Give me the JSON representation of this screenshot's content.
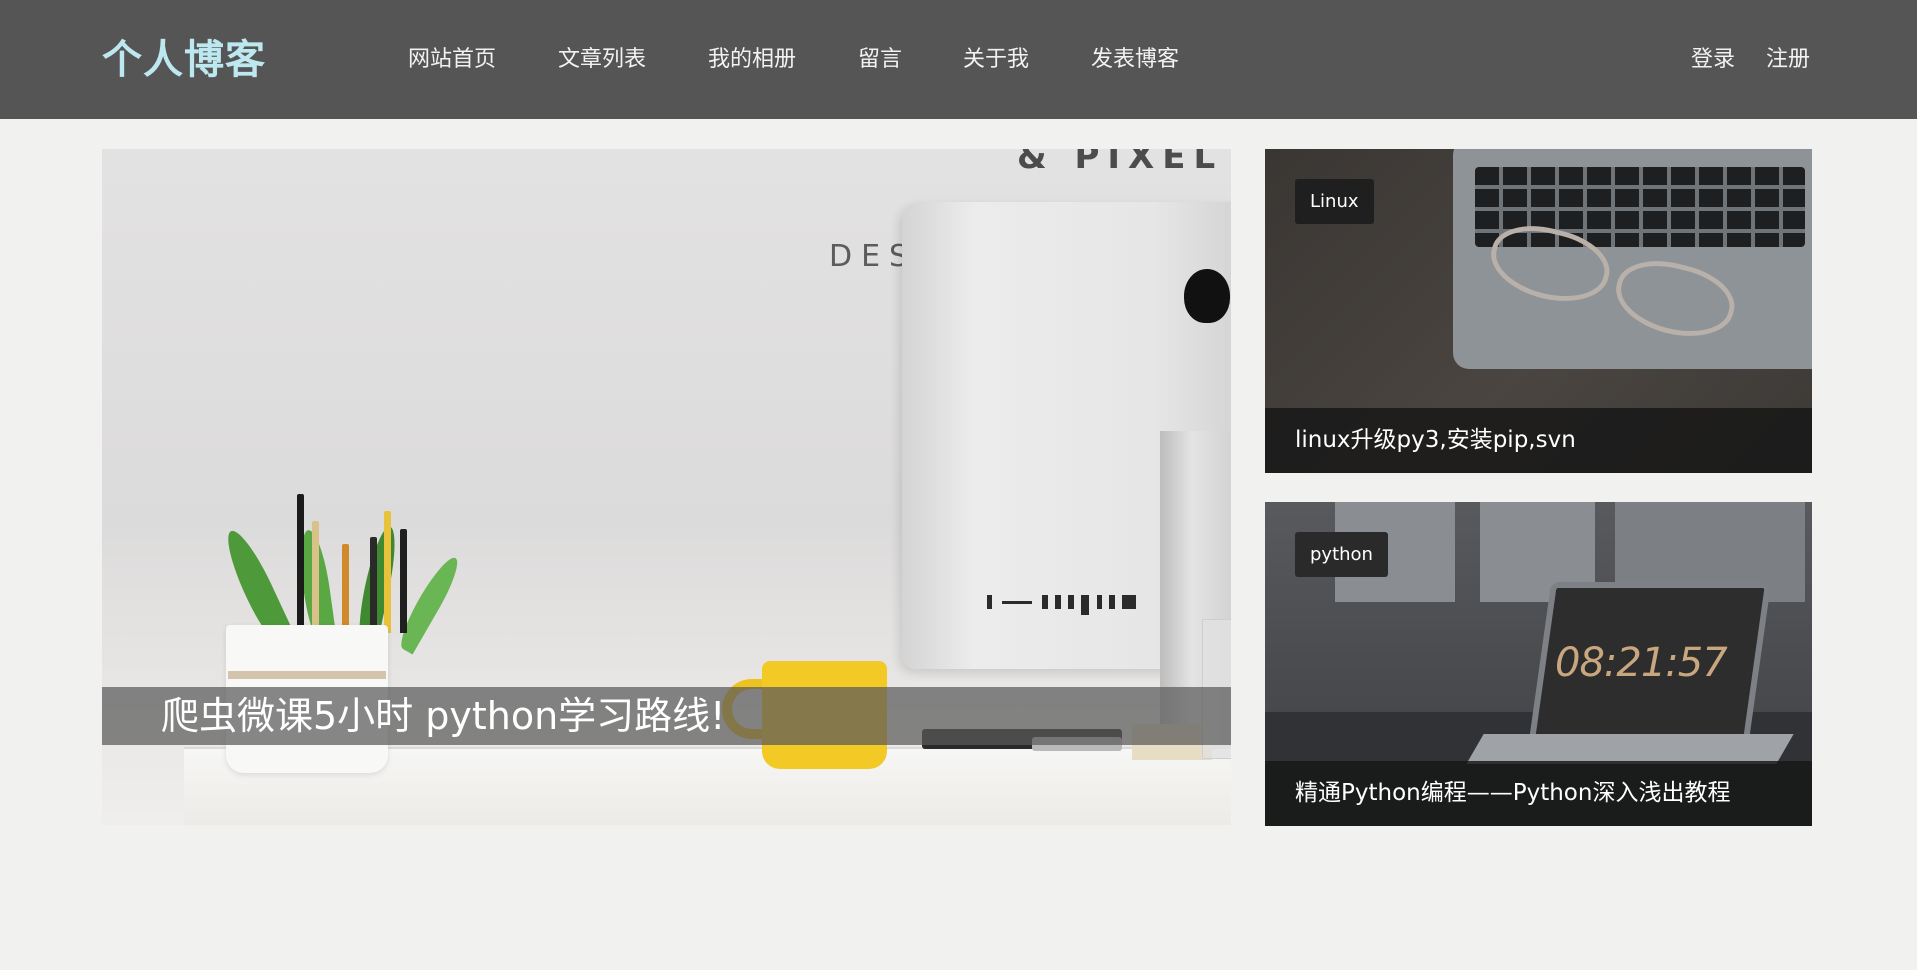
{
  "header": {
    "logo": "个人博客",
    "nav": [
      {
        "label": "网站首页"
      },
      {
        "label": "文章列表"
      },
      {
        "label": "我的相册"
      },
      {
        "label": "留言"
      },
      {
        "label": "关于我"
      },
      {
        "label": "发表博客"
      }
    ],
    "auth": {
      "login": "登录",
      "register": "注册"
    }
  },
  "hero": {
    "title": "爬虫微课5小时 python学习路线!",
    "wall_text_top": "& PIXEL",
    "wall_text_mid": "DES",
    "image": "desk-with-monitor-plant-and-yellow-mug"
  },
  "cards": [
    {
      "tag": "Linux",
      "title": "linux升级py3,安装pip,svn",
      "image": "laptop-keyboard-with-glasses"
    },
    {
      "tag": "python",
      "title": "精通Python编程——Python深入浅出教程",
      "image": "laptop-showing-clock",
      "clock": "08:21:57"
    }
  ],
  "colors": {
    "header_bg": "#555555",
    "logo": "#bde8ef",
    "page_bg": "#f1f1ef",
    "caption_bg": "#5a5a5a",
    "tag_bg": "#1f1f1f"
  }
}
